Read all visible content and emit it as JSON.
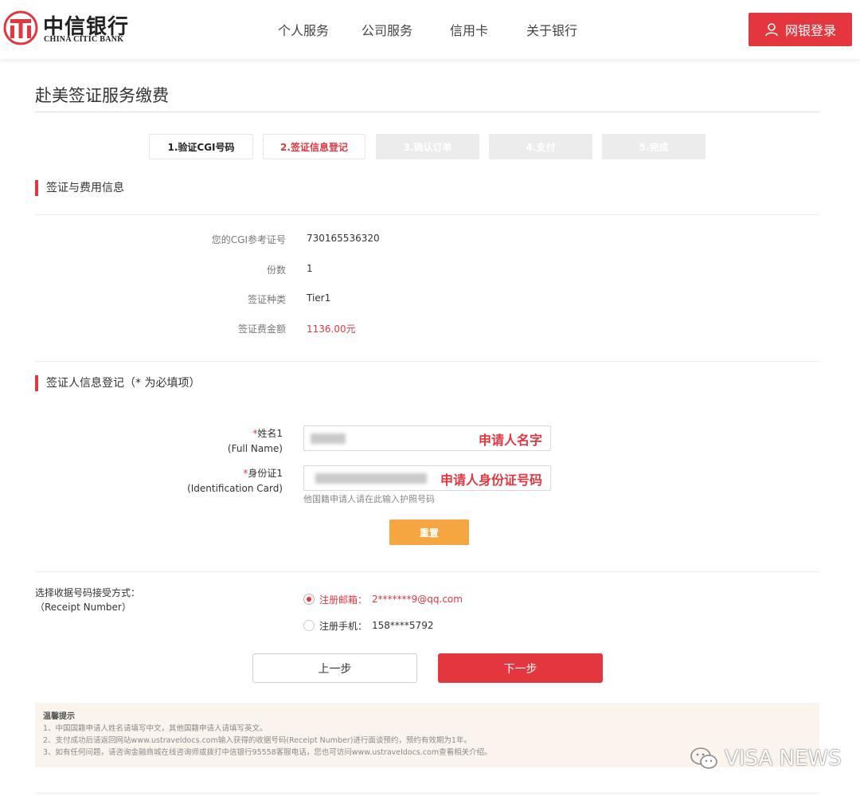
{
  "brand": {
    "name_cn": "中信银行",
    "name_en": "CHINA CITIC BANK",
    "color": "#e3363f"
  },
  "nav": {
    "items": [
      "个人服务",
      "公司服务",
      "信用卡",
      "关于银行"
    ],
    "login_label": "网银登录"
  },
  "page": {
    "title": "赴美签证服务缴费"
  },
  "steps": [
    {
      "label": "1.验证CGI号码",
      "state": "done"
    },
    {
      "label": "2.签证信息登记",
      "state": "active"
    },
    {
      "label": "3.确认订单",
      "state": "todo"
    },
    {
      "label": "4.支付",
      "state": "todo"
    },
    {
      "label": "5.完成",
      "state": "todo"
    }
  ],
  "visa_info": {
    "heading": "签证与费用信息",
    "rows": [
      {
        "label": "您的CGI参考证号",
        "value": "730165536320"
      },
      {
        "label": "份数",
        "value": "1"
      },
      {
        "label": "签证种类",
        "value": "Tier1"
      },
      {
        "label": "签证费金额",
        "value": "1136.00元"
      }
    ]
  },
  "applicant": {
    "heading": "签证人信息登记（* 为必填项）",
    "required_mark": "*",
    "name_label": "姓名1",
    "name_label_en": "(Full Name)",
    "name_annotation": "申请人名字",
    "id_label": "身份证1",
    "id_label_en": "(Identification Card)",
    "id_annotation": "申请人身份证号码",
    "id_hint": "他国籍申请人请在此输入护照号码",
    "reset_label": "重置"
  },
  "receipt": {
    "label": "选择收据号码接受方式：",
    "label_en": "（Receipt Number）",
    "options": [
      {
        "label": "注册邮箱：",
        "value": "2*******9@qq.com",
        "selected": true
      },
      {
        "label": "注册手机：",
        "value": "158****5792",
        "selected": false
      }
    ]
  },
  "actions": {
    "prev_label": "上一步",
    "next_label": "下一步"
  },
  "tips": {
    "title": "温馨提示",
    "lines": [
      "1、中国国籍申请人姓名请填写中文，其他国籍申请人请填写英文。",
      "2、支付成功后请返回网站www.ustraveldocs.com输入获得的收据号码(Receipt Number)进行面谈预约，预约有效期为1年。",
      "3、如有任何问题，请咨询金融商城在线咨询师或拨打中信银行95558客服电话，您也可访问www.ustraveldocs.com查看相关介绍。"
    ]
  },
  "watermark": {
    "text": "VISA NEWS",
    "icon": "wechat-icon"
  }
}
